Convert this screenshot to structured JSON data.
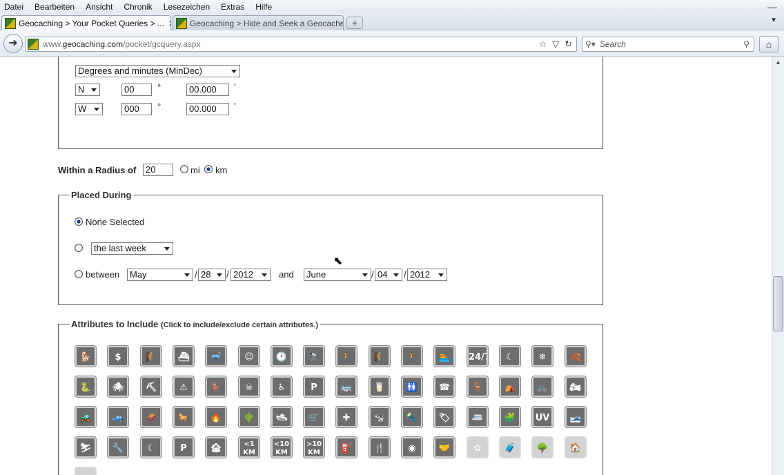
{
  "menu": [
    "Datei",
    "Bearbeiten",
    "Ansicht",
    "Chronik",
    "Lesezeichen",
    "Extras",
    "Hilfe"
  ],
  "tabs": [
    {
      "title": "Geocaching > Your Pocket Queries > ..."
    },
    {
      "title": "Geocaching > Hide and Seek a Geocache..."
    }
  ],
  "address": {
    "url_prefix": "www.",
    "url_domain": "geocaching.com",
    "url_path": "/pocket/gcquery.aspx"
  },
  "search": {
    "placeholder": "Search"
  },
  "coordinates": {
    "format": "Degrees and minutes (MinDec)",
    "lat_dir": "N",
    "lat_deg": "00",
    "lat_min": "00.000",
    "lon_dir": "W",
    "lon_deg": "000",
    "lon_min": "00.000",
    "deg_symbol": "°",
    "min_symbol": "'"
  },
  "radius": {
    "label": "Within a Radius of",
    "value": "20",
    "unit_mi": "mi",
    "unit_km": "km",
    "selected": "km"
  },
  "placed": {
    "legend": "Placed During",
    "none_label": "None Selected",
    "last_option": "the last week",
    "between_label": "between",
    "and_label": "and",
    "from_month": "May",
    "from_day": "28",
    "from_year": "2012",
    "to_month": "June",
    "to_day": "04",
    "to_year": "2012",
    "selected": "none"
  },
  "attributes": {
    "legend": "Attributes to Include",
    "hint": "(Click to include/exclude certain attributes.)",
    "rows": [
      [
        {
          "name": "dogs-icon",
          "glyph": "🐕"
        },
        {
          "name": "fee-icon",
          "glyph": "$"
        },
        {
          "name": "climbing-icon",
          "glyph": "🧗"
        },
        {
          "name": "boat-icon",
          "glyph": "⛴"
        },
        {
          "name": "scuba-icon",
          "glyph": "🤿"
        },
        {
          "name": "kids-icon",
          "glyph": "☺"
        },
        {
          "name": "time-icon",
          "glyph": "🕑"
        },
        {
          "name": "scenic-icon",
          "glyph": "🔭"
        },
        {
          "name": "hiking-icon",
          "glyph": "🚶"
        },
        {
          "name": "difficult-climb-icon",
          "glyph": "🧗"
        },
        {
          "name": "wading-icon",
          "glyph": "🚶"
        },
        {
          "name": "swimming-icon",
          "glyph": "🏊"
        },
        {
          "name": "available-24-7-icon",
          "glyph": "24/7"
        },
        {
          "name": "night-icon",
          "glyph": "☾"
        },
        {
          "name": "winter-icon",
          "glyph": "❄"
        },
        {
          "name": "poison-oak-icon",
          "glyph": "🍂"
        }
      ],
      [
        {
          "name": "snakes-icon",
          "glyph": "🐍"
        },
        {
          "name": "ticks-icon",
          "glyph": "🕷"
        },
        {
          "name": "mine-icon",
          "glyph": "⛏"
        },
        {
          "name": "cliff-icon",
          "glyph": "⚠"
        },
        {
          "name": "hunting-icon",
          "glyph": "🦌"
        },
        {
          "name": "danger-icon",
          "glyph": "☠"
        },
        {
          "name": "wheelchair-icon",
          "glyph": "♿"
        },
        {
          "name": "parking-icon",
          "glyph": "P"
        },
        {
          "name": "public-transit-icon",
          "glyph": "🚌"
        },
        {
          "name": "drinking-water-icon",
          "glyph": "🥛"
        },
        {
          "name": "restrooms-icon",
          "glyph": "🚻"
        },
        {
          "name": "phone-icon",
          "glyph": "☎"
        },
        {
          "name": "picnic-icon",
          "glyph": "🪑"
        },
        {
          "name": "camping-icon",
          "glyph": "⛺"
        },
        {
          "name": "bicycles-icon",
          "glyph": "🚲"
        },
        {
          "name": "motorcycles-icon",
          "glyph": "🏍"
        }
      ],
      [
        {
          "name": "quads-icon",
          "glyph": "🚜"
        },
        {
          "name": "jeeps-icon",
          "glyph": "🚙"
        },
        {
          "name": "snowmobiles-icon",
          "glyph": "🛷"
        },
        {
          "name": "horses-icon",
          "glyph": "🐎"
        },
        {
          "name": "campfires-icon",
          "glyph": "🔥"
        },
        {
          "name": "thorns-icon",
          "glyph": "🌵"
        },
        {
          "name": "stealth-icon",
          "glyph": "🛥"
        },
        {
          "name": "stroller-icon",
          "glyph": "🛒"
        },
        {
          "name": "first-aid-icon",
          "glyph": "✚"
        },
        {
          "name": "cow-icon",
          "glyph": "🐄"
        },
        {
          "name": "flashlight-icon",
          "glyph": "🔦"
        },
        {
          "name": "landf-icon",
          "glyph": "🏷"
        },
        {
          "name": "rv-icon",
          "glyph": "🚐"
        },
        {
          "name": "field-puzzle-icon",
          "glyph": "🧩"
        },
        {
          "name": "uv-icon",
          "glyph": "UV"
        },
        {
          "name": "snowshoes-icon",
          "glyph": "🎿"
        }
      ],
      [
        {
          "name": "skiis-icon",
          "glyph": "⛷"
        },
        {
          "name": "special-tool-icon",
          "glyph": "🔧"
        },
        {
          "name": "night-cache-icon",
          "glyph": "☾"
        },
        {
          "name": "park-and-grab-icon",
          "glyph": "P"
        },
        {
          "name": "abandoned-structure-icon",
          "glyph": "🏚"
        },
        {
          "name": "short-hike-icon",
          "glyph": "<1 KM",
          "small": true
        },
        {
          "name": "medium-hike-icon",
          "glyph": "<10 KM",
          "small": true
        },
        {
          "name": "long-hike-icon",
          "glyph": ">10 KM",
          "small": true
        },
        {
          "name": "fuel-icon",
          "glyph": "⛽"
        },
        {
          "name": "food-icon",
          "glyph": "🍴"
        },
        {
          "name": "wireless-beacon-icon",
          "glyph": "◉"
        },
        {
          "name": "partnership-icon",
          "glyph": "🤝"
        },
        {
          "name": "seasonal-icon",
          "glyph": "✿",
          "faded": true
        },
        {
          "name": "tourist-icon",
          "glyph": "🧳",
          "faded": true
        },
        {
          "name": "tree-climbing-icon",
          "glyph": "🌳",
          "faded": true
        },
        {
          "name": "front-yard-icon",
          "glyph": "🏠",
          "faded": true
        }
      ],
      [
        {
          "name": "teamwork-icon",
          "glyph": "👥",
          "faded": true
        }
      ]
    ]
  },
  "colors": {
    "icon_bg": "#6d6d6d",
    "icon_faded": "#d2d2d2",
    "radio_dot": "#1d3f8a"
  }
}
